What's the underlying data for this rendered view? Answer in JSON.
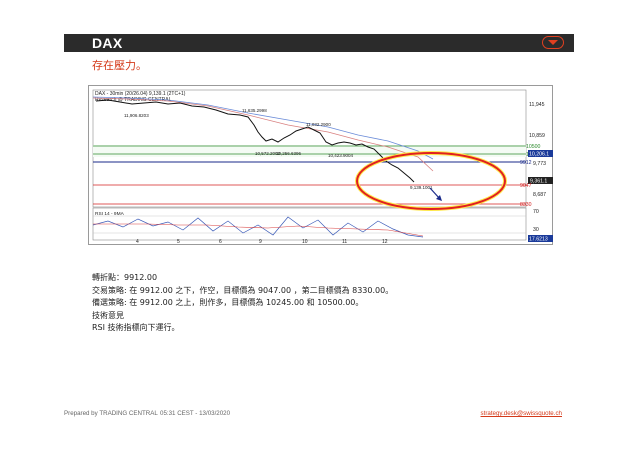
{
  "header": {
    "title": "DAX"
  },
  "subtitle": "存在壓力。",
  "chart": {
    "legend_line1": "DAX - 30min (20/26.04) 9,139.1 (2TC+1)",
    "legend_line2": "Research @ TRADING CENTRAL",
    "price_annotations": [
      "11,635.2998",
      "11,906.8203",
      "11,032.2900",
      "10,572.2002",
      "10,256.6396",
      "10,423.9004",
      "9,139.1001"
    ],
    "right_axis_labels": [
      "11,945",
      "10,859",
      "10500",
      "10245",
      "10,206.1",
      "9,773",
      "9912",
      "9,361.1",
      "9047",
      "8,687",
      "8330",
      "70",
      "30",
      "17.6213"
    ],
    "rsi_label": "RSI 14 - 9MA",
    "x_axis_labels": [
      "4",
      "5",
      "6",
      "9",
      "10",
      "11",
      "12"
    ],
    "colors": {
      "resistance": "#2e8b2e",
      "pivot": "#1a2a8a",
      "support": "#d42020",
      "highlight": "#e02020",
      "ellipse_fill": "#ffe84a"
    }
  },
  "notes": {
    "pivot": "轉折點：9912.00",
    "strategy": "交易策略: 在   9912.00 之下，作空，目標價為  9047.00 ，第二目標價為  8330.00。",
    "alternative": "備選策略: 在   9912.00 之上，則作多，目標價為  10245.00 和 10500.00。",
    "comment_title": "技術意見",
    "comment": "RSI 技術指標向下運行。"
  },
  "footer": {
    "prepared_by": "Prepared by TRADING CENTRAL",
    "timestamp": "05:31 CEST - 13/03/2020",
    "email": "strategy.desk@swissquote.ch"
  }
}
